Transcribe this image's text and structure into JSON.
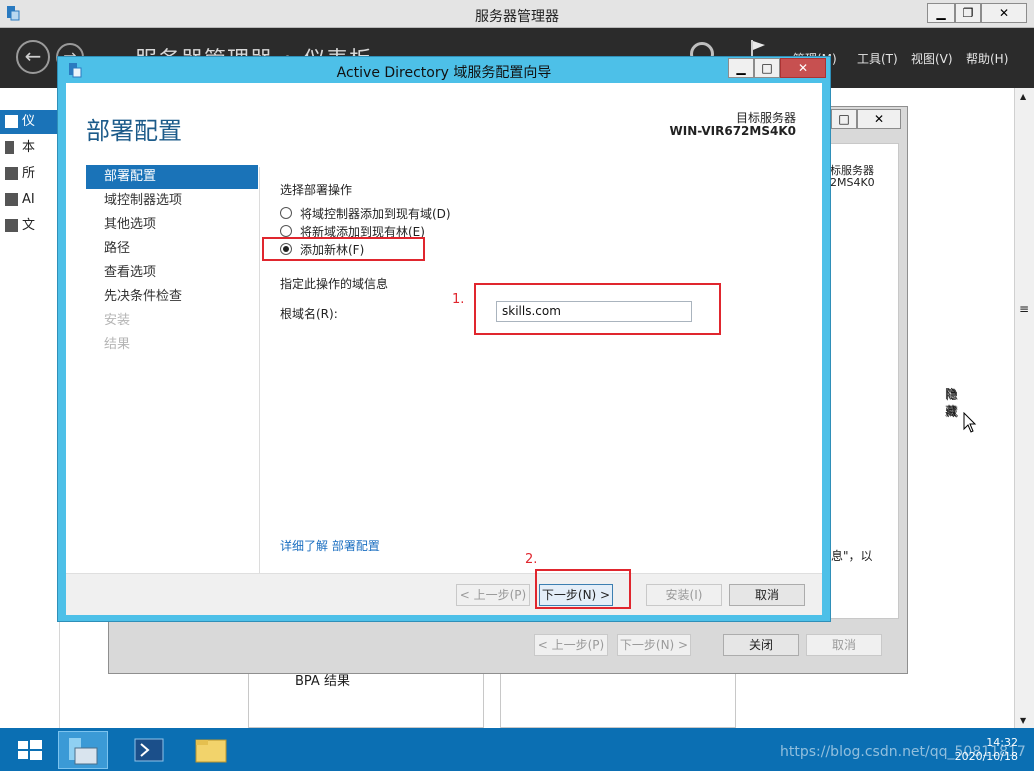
{
  "server_manager": {
    "title": "服务器管理器",
    "breadcrumb": "服务器管理器 • 仪表板",
    "menu": [
      "管理(M)",
      "工具(T)",
      "视图(V)",
      "帮助(H)"
    ],
    "left_items": [
      "仪",
      "本",
      "所",
      "AI",
      "文"
    ],
    "bg_fragments": {
      "target_label": "标服务器",
      "target_name": "2MS4K0",
      "hide": "隐藏",
      "info": "息\"，以",
      "bpa": "BPA 结果"
    },
    "window_buttons": {
      "minimize": "▁",
      "restore": "❐",
      "close": "✕"
    }
  },
  "bg_wizard": {
    "buttons": {
      "prev": "< 上一步(P)",
      "next": "下一步(N) >",
      "close": "关闭",
      "cancel": "取消"
    }
  },
  "wizard": {
    "title": "Active Directory 域服务配置向导",
    "heading": "部署配置",
    "target_label": "目标服务器",
    "target_name": "WIN-VIR672MS4K0",
    "steps": [
      {
        "label": "部署配置",
        "state": "active"
      },
      {
        "label": "域控制器选项",
        "state": "normal"
      },
      {
        "label": "其他选项",
        "state": "normal"
      },
      {
        "label": "路径",
        "state": "normal"
      },
      {
        "label": "查看选项",
        "state": "normal"
      },
      {
        "label": "先决条件检查",
        "state": "normal"
      },
      {
        "label": "安装",
        "state": "disabled"
      },
      {
        "label": "结果",
        "state": "disabled"
      }
    ],
    "select_operation_label": "选择部署操作",
    "options": [
      {
        "label": "将域控制器添加到现有域(D)",
        "selected": false
      },
      {
        "label": "将新域添加到现有林(E)",
        "selected": false
      },
      {
        "label": "添加新林(F)",
        "selected": true
      }
    ],
    "domain_info_label": "指定此操作的域信息",
    "root_domain_label": "根域名(R):",
    "root_domain_value": "skills.com",
    "learn_more": "详细了解 部署配置",
    "buttons": {
      "prev": "< 上一步(P)",
      "next": "下一步(N) >",
      "install": "安装(I)",
      "cancel": "取消"
    }
  },
  "annotations": {
    "one": "1.",
    "two": "2."
  },
  "taskbar": {
    "time": "14:32",
    "date": "2020/10/18"
  },
  "watermark": "https://blog.csdn.net/qq_50811817",
  "colors": {
    "accent": "#1a73b8",
    "wizard_frame": "#4dc0e8",
    "annotation": "#e0262e",
    "taskbar": "#0b6fb3"
  }
}
